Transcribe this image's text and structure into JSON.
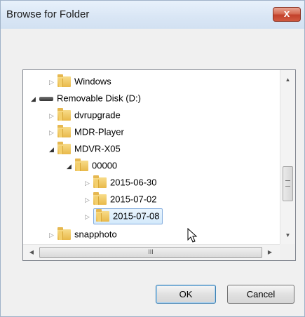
{
  "window": {
    "title": "Browse for Folder",
    "close_label": "x"
  },
  "tree": {
    "items": [
      {
        "label": "Windows",
        "type": "folder",
        "expanded": false
      },
      {
        "label": "Removable Disk (D:)",
        "type": "drive",
        "expanded": true
      },
      {
        "label": "dvrupgrade",
        "type": "folder",
        "expanded": false
      },
      {
        "label": "MDR-Player",
        "type": "folder",
        "expanded": false
      },
      {
        "label": "MDVR-X05",
        "type": "folder",
        "expanded": true
      },
      {
        "label": "00000",
        "type": "folder",
        "expanded": true
      },
      {
        "label": "2015-06-30",
        "type": "folder",
        "expanded": false
      },
      {
        "label": "2015-07-02",
        "type": "folder",
        "expanded": false
      },
      {
        "label": "2015-07-08",
        "type": "folder",
        "expanded": false,
        "selected": true
      },
      {
        "label": "snapphoto",
        "type": "folder",
        "expanded": false
      }
    ]
  },
  "scrollbar": {
    "h_thumb_grip": "III"
  },
  "buttons": {
    "ok": "OK",
    "cancel": "Cancel"
  },
  "colors": {
    "selection_bg": "#d3e9fb",
    "selection_border": "#84acdd",
    "close_button": "#c2412c"
  }
}
